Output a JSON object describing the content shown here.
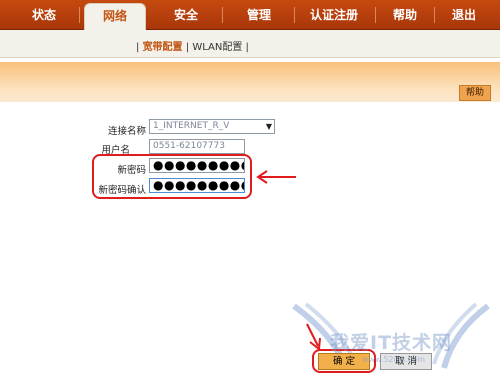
{
  "nav": {
    "items": [
      {
        "label": "状态"
      },
      {
        "label": "网络"
      },
      {
        "label": "安全"
      },
      {
        "label": "管理"
      },
      {
        "label": "认证注册"
      },
      {
        "label": "帮助"
      },
      {
        "label": "退出"
      }
    ],
    "active_label": "网络"
  },
  "subnav": {
    "separator": "|",
    "items": [
      {
        "label": "宽带配置"
      },
      {
        "label": "WLAN配置"
      }
    ],
    "active_label": "宽带配置"
  },
  "help_label": "帮助",
  "form": {
    "connection_name_label": "连接名称",
    "connection_name_value": "1_INTERNET_R_V",
    "username_label": "用户名",
    "username_value": "0551-62107773",
    "new_password_label": "新密码",
    "new_password_value": "●●●●●●●●●●",
    "confirm_password_label": "新密码确认",
    "confirm_password_value": "●●●●●●●●●●"
  },
  "buttons": {
    "ok_label": "确 定",
    "cancel_label": "取 消"
  },
  "watermark": {
    "text": "我爱IT技术网",
    "url": "www.52itjs.com"
  },
  "colors": {
    "nav_bg": "#b23f0c",
    "accent": "#c25513",
    "annotation_red": "#e01c1c",
    "ok_button": "#f2b04a"
  }
}
